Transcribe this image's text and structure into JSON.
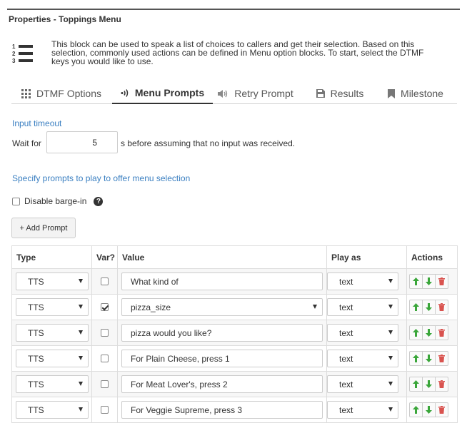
{
  "panel": {
    "title": "Properties - Toppings Menu",
    "description": "This block can be used to speak a list of choices to callers and get their selection. Based on this selection, commonly used actions can be defined in Menu option blocks. To start, select the DTMF keys you would like to use.",
    "description_icon": "numbered-list-icon"
  },
  "tabs": [
    {
      "label": "DTMF Options",
      "icon": "grid-icon",
      "active": false
    },
    {
      "label": "Menu Prompts",
      "icon": "sound-waves-icon",
      "active": true
    },
    {
      "label": "Retry Prompt",
      "icon": "speaker-icon",
      "active": false
    },
    {
      "label": "Results",
      "icon": "save-icon",
      "active": false
    },
    {
      "label": "Milestone",
      "icon": "bookmark-icon",
      "active": false
    }
  ],
  "input_timeout": {
    "section_label": "Input timeout",
    "wait_label": "Wait for",
    "wait_value": "5",
    "wait_suffix": "s before assuming that no input was received."
  },
  "prompts_section": {
    "section_label": "Specify prompts to play to offer menu selection",
    "barge_in_label": "Disable barge-in",
    "barge_in_checked": false,
    "help_glyph": "?",
    "add_prompt_label": "+ Add Prompt"
  },
  "table": {
    "headers": {
      "type": "Type",
      "var": "Var?",
      "value": "Value",
      "play_as": "Play as",
      "actions": "Actions"
    },
    "rows": [
      {
        "type": "TTS",
        "var": false,
        "value": "What kind of",
        "value_is_select": false,
        "play_as": "text"
      },
      {
        "type": "TTS",
        "var": true,
        "value": "pizza_size",
        "value_is_select": true,
        "play_as": "text"
      },
      {
        "type": "TTS",
        "var": false,
        "value": "pizza would you like?",
        "value_is_select": false,
        "play_as": "text"
      },
      {
        "type": "TTS",
        "var": false,
        "value": "For Plain Cheese, press 1",
        "value_is_select": false,
        "play_as": "text"
      },
      {
        "type": "TTS",
        "var": false,
        "value": "For Meat Lover's, press 2",
        "value_is_select": false,
        "play_as": "text"
      },
      {
        "type": "TTS",
        "var": false,
        "value": "For Veggie Supreme, press 3",
        "value_is_select": false,
        "play_as": "text"
      }
    ]
  },
  "colors": {
    "section_label": "#3a7fc1",
    "move_up": "#3aa63a",
    "move_down": "#3aa63a",
    "delete": "#d9534f"
  }
}
